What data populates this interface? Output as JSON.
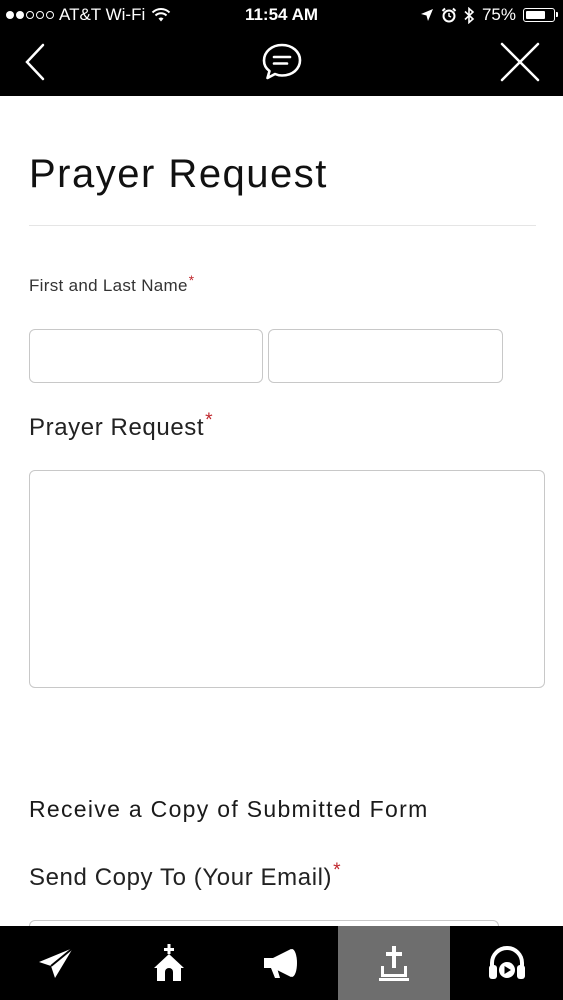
{
  "status_bar": {
    "carrier": "AT&T Wi-Fi",
    "time": "11:54 AM",
    "battery": "75%",
    "battery_level": 0.75,
    "signal_bars_filled": 2,
    "signal_bars_total": 5
  },
  "nav": {
    "back_icon": "chevron-left-icon",
    "center_icon": "chat-bubble-icon",
    "close_icon": "close-icon"
  },
  "form": {
    "title": "Prayer Request",
    "name_label": "First and Last Name",
    "first_name_value": "",
    "last_name_value": "",
    "prayer_label": "Prayer Request",
    "prayer_value": "",
    "copy_heading": "Receive a Copy of Submitted Form",
    "email_label": "Send Copy To (Your Email)",
    "email_value": "",
    "required_marker": "*"
  },
  "tabbar": {
    "active_index": 3,
    "tabs": [
      {
        "icon": "paper-plane-icon"
      },
      {
        "icon": "church-icon"
      },
      {
        "icon": "megaphone-icon"
      },
      {
        "icon": "prayer-upload-icon"
      },
      {
        "icon": "headphones-play-icon"
      }
    ]
  },
  "colors": {
    "header_bg": "#000000",
    "required": "#c0272d",
    "active_tab": "#6e6e6e"
  }
}
